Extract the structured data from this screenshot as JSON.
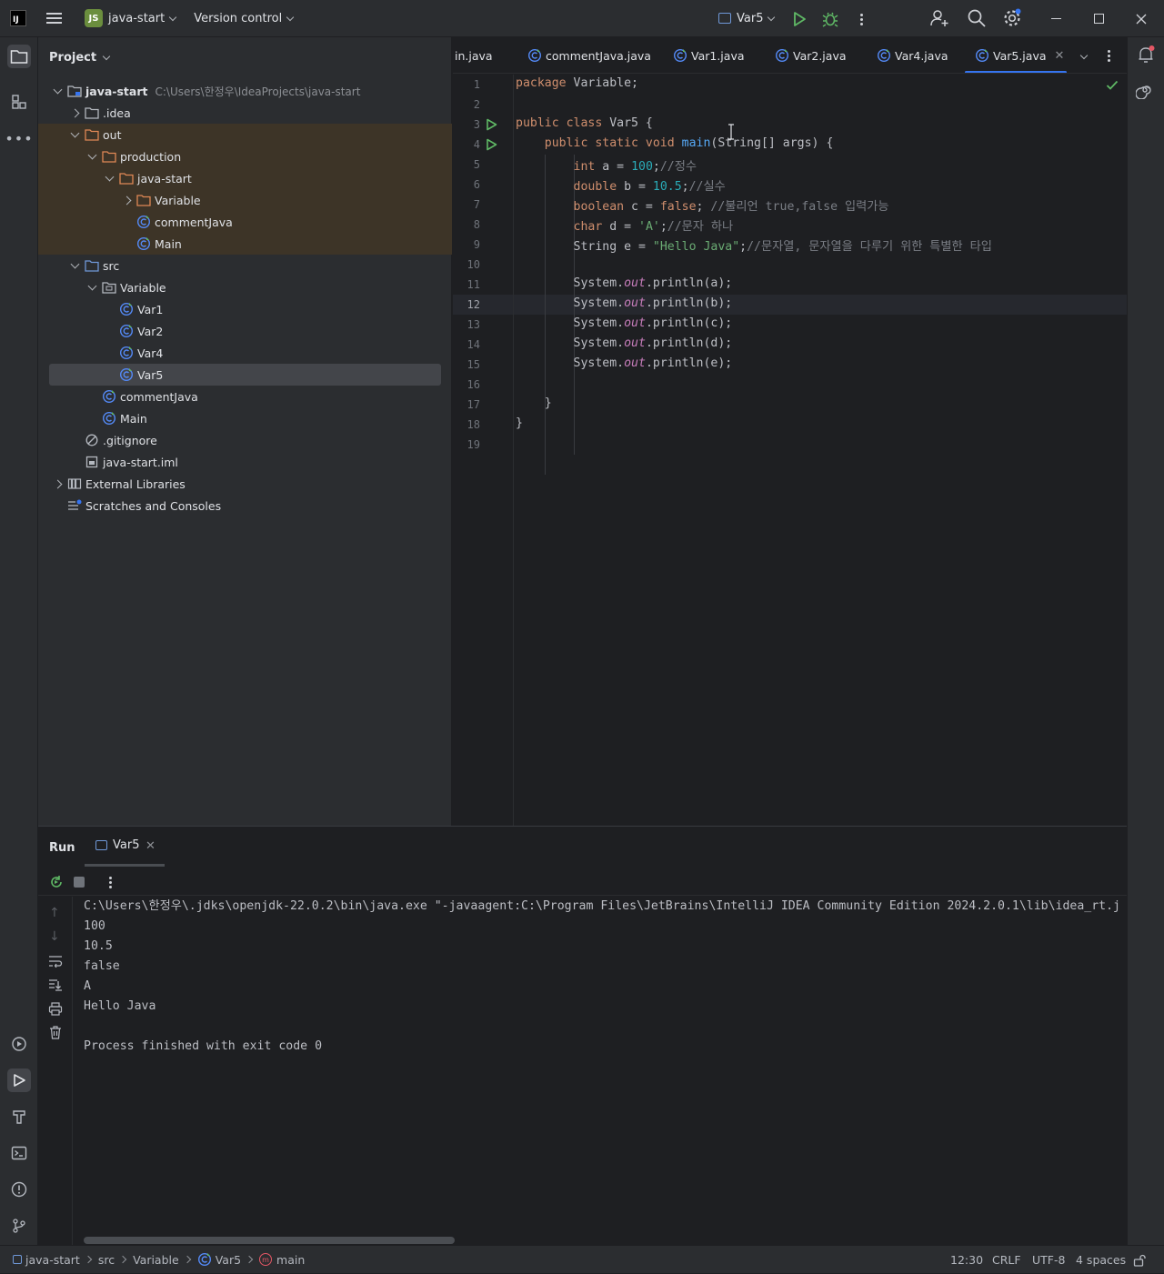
{
  "titlebar": {
    "project_badge": "JS",
    "project_name": "java-start",
    "vcs": "Version control",
    "run_config": "Var5"
  },
  "project_panel": {
    "title": "Project",
    "root_path": "C:\\Users\\한정우\\IdeaProjects\\java-start",
    "items": [
      {
        "label": "java-start"
      },
      {
        "label": ".idea"
      },
      {
        "label": "out"
      },
      {
        "label": "production"
      },
      {
        "label": "java-start"
      },
      {
        "label": "Variable"
      },
      {
        "label": "commentJava"
      },
      {
        "label": "Main"
      },
      {
        "label": "src"
      },
      {
        "label": "Variable"
      },
      {
        "label": "Var1"
      },
      {
        "label": "Var2"
      },
      {
        "label": "Var4"
      },
      {
        "label": "Var5"
      },
      {
        "label": "commentJava"
      },
      {
        "label": "Main"
      },
      {
        "label": ".gitignore"
      },
      {
        "label": "java-start.iml"
      },
      {
        "label": "External Libraries"
      },
      {
        "label": "Scratches and Consoles"
      }
    ]
  },
  "tabs": [
    {
      "label": "in.java"
    },
    {
      "label": "commentJava.java"
    },
    {
      "label": "Var1.java"
    },
    {
      "label": "Var2.java"
    },
    {
      "label": "Var4.java"
    },
    {
      "label": "Var5.java"
    }
  ],
  "editor": {
    "line_numbers": [
      "1",
      "2",
      "3",
      "4",
      "5",
      "6",
      "7",
      "8",
      "9",
      "10",
      "11",
      "12",
      "13",
      "14",
      "15",
      "16",
      "17",
      "18",
      "19"
    ],
    "current_line": "12",
    "code": {
      "l1_kw": "package",
      "l1_rest": " Variable;",
      "l3_kw": "public class",
      "l3_rest": " Var5 {",
      "l4_kw": "public static void",
      "l4_fn": "main",
      "l4_rest": "(String[] args) {",
      "l5_kw": "int",
      "l5_a": " a = ",
      "l5_num": "100",
      "l5_b": ";",
      "l5_cmt": "//정수",
      "l6_kw": "double",
      "l6_a": " b = ",
      "l6_num": "10.5",
      "l6_b": ";",
      "l6_cmt": "//실수",
      "l7_kw": "boolean",
      "l7_a": " c = ",
      "l7_kw2": "false",
      "l7_b": "; ",
      "l7_cmt": "//불리언 true,false 입력가능",
      "l8_kw": "char",
      "l8_a": " d = ",
      "l8_str": "'A'",
      "l8_b": ";",
      "l8_cmt": "//문자 하나",
      "l9_a": "String e = ",
      "l9_str": "\"Hello Java\"",
      "l9_b": ";",
      "l9_cmt": "//문자열, 문자열을 다루기 위한 특별한 타입",
      "sys": "System.",
      "out": "out",
      "println_a": ".println(a);",
      "println_b": ".println(b);",
      "println_c": ".println(c);",
      "println_d": ".println(d);",
      "println_e": ".println(e);",
      "l17": "}",
      "l18": "}"
    }
  },
  "run_panel": {
    "title": "Run",
    "tab": "Var5",
    "console": [
      "C:\\Users\\한정우\\.jdks\\openjdk-22.0.2\\bin\\java.exe \"-javaagent:C:\\Program Files\\JetBrains\\IntelliJ IDEA Community Edition 2024.2.0.1\\lib\\idea_rt.j",
      "100",
      "10.5",
      "false",
      "A",
      "Hello Java",
      "",
      "Process finished with exit code 0"
    ]
  },
  "statusbar": {
    "breadcrumbs": [
      "java-start",
      "src",
      "Variable",
      "Var5",
      "main"
    ],
    "position": "12:30",
    "line_sep": "CRLF",
    "encoding": "UTF-8",
    "indent": "4 spaces"
  },
  "colors": {
    "accent": "#3574f0",
    "keyword": "#cf8e6d",
    "number": "#2aacb8",
    "string": "#6aab73",
    "comment": "#7a7e85",
    "function": "#56a8f5",
    "static_field": "#c77dbb",
    "run_green": "#5fb865"
  }
}
